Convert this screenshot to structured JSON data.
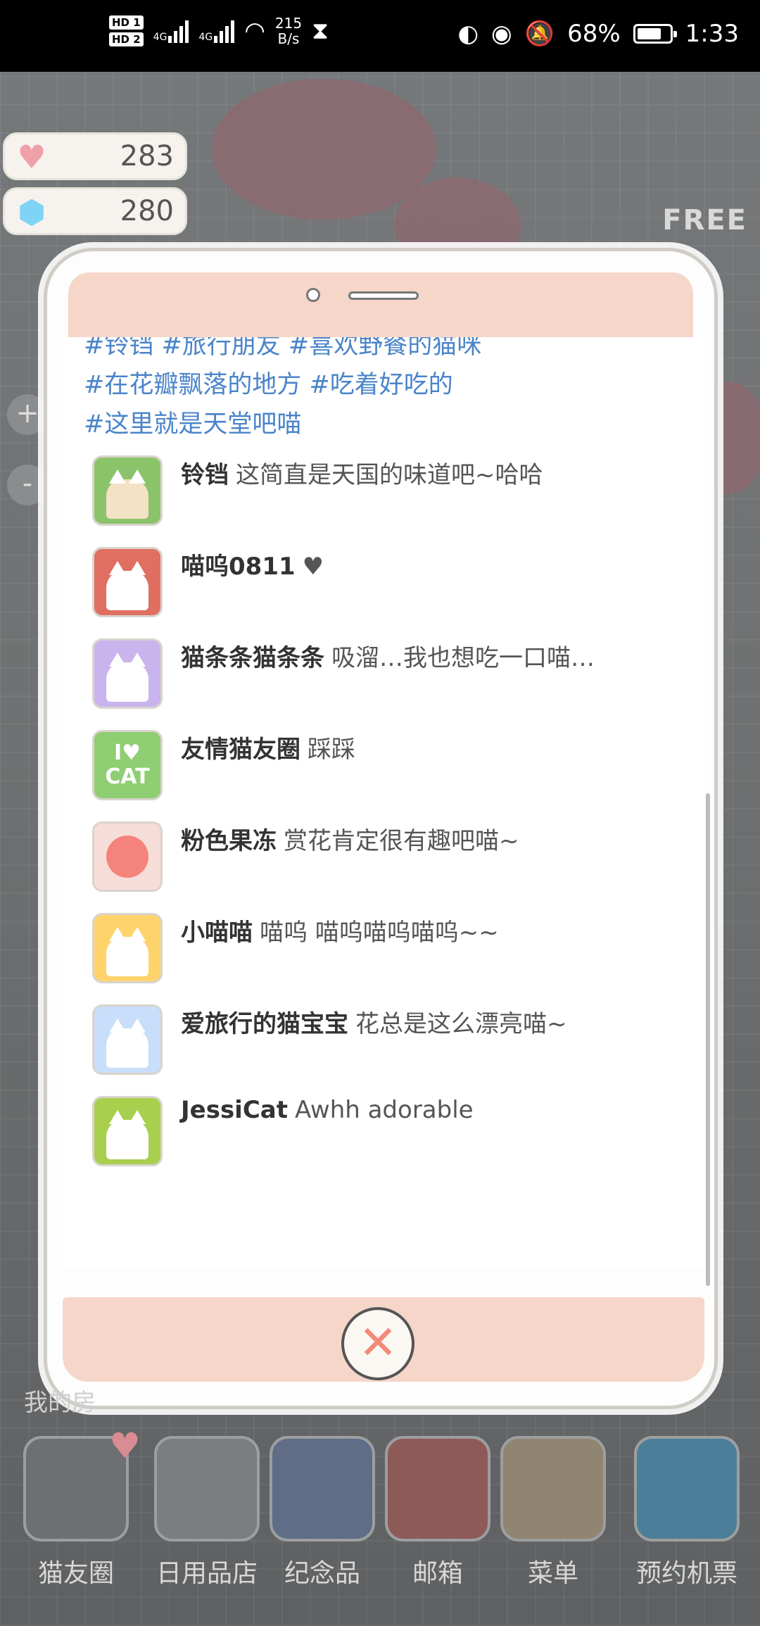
{
  "status_bar": {
    "hd1": "HD 1",
    "hd2": "HD 2",
    "net1": "4G",
    "net2": "4G",
    "speed_value": "215",
    "speed_unit": "B/s",
    "battery": "68%",
    "time": "1:33"
  },
  "currency": {
    "hearts": "283",
    "gems": "280"
  },
  "free_badge": "FREE",
  "zoom": {
    "plus": "+",
    "minus": "-"
  },
  "post": {
    "tags": [
      "#铃铛 #旅行朋友 #喜欢野餐的猫咪",
      "#在花瓣飘落的地方 #吃着好吃的",
      "#这里就是天堂吧喵"
    ]
  },
  "comments": [
    {
      "name": "铃铛",
      "text": "这简直是天国的味道吧~哈哈",
      "avatar_color": "#8bc36a"
    },
    {
      "name": "喵呜0811",
      "text": "♥",
      "avatar_color": "#e06f62"
    },
    {
      "name": "猫条条猫条条",
      "text": "吸溜…我也想吃一口喵…",
      "avatar_color": "#c9b4ee"
    },
    {
      "name": "友情猫友圈",
      "text": "踩踩",
      "avatar_color": "#8fce72"
    },
    {
      "name": "粉色果冻",
      "text": "赏花肯定很有趣吧喵~",
      "avatar_color": "#f7ddd8"
    },
    {
      "name": "小喵喵",
      "text": "喵呜 喵呜喵呜喵呜~~",
      "avatar_color": "#ffd36b"
    },
    {
      "name": "爱旅行的猫宝宝",
      "text": "花总是这么漂亮喵~",
      "avatar_color": "#c8defa"
    },
    {
      "name": "JessiCat",
      "text": "Awhh adorable",
      "avatar_color": "#a8cf4d"
    }
  ],
  "avatar_text": {
    "line1": "I♥",
    "line2": "CAT"
  },
  "close_symbol": "✕",
  "partial_label": "我的房",
  "bottom_nav": [
    {
      "label": "猫友圈"
    },
    {
      "label": "日用品店"
    },
    {
      "label": "纪念品"
    },
    {
      "label": "邮箱"
    },
    {
      "label": "菜单"
    },
    {
      "label": "预约机票"
    }
  ]
}
